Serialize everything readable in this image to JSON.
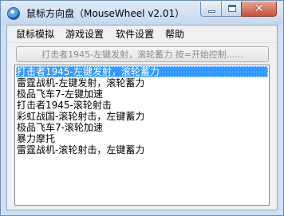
{
  "window": {
    "title": "鼠标方向盘（MouseWheel v2.01）",
    "close_glyph": "✕",
    "accent": "#3399ff"
  },
  "menu": [
    "鼠标模拟",
    "游戏设置",
    "软件设置",
    "帮助"
  ],
  "action_button": {
    "label": "打击者1945-左键发射，滚轮蓄力 按=开始控制......"
  },
  "list": {
    "items": [
      "打击者1945-左键发射，滚轮蓄力",
      "雷霆战机-左键发射，滚轮蓄力",
      "极品飞车7-左键加速",
      "打击者1945-滚轮射击",
      "彩虹战国-滚轮射击，左键蓄力",
      "极品飞车7-滚轮加速",
      "暴力摩托",
      "雷霆战机-滚轮射击，左键蓄力"
    ],
    "selected_index": 0
  }
}
